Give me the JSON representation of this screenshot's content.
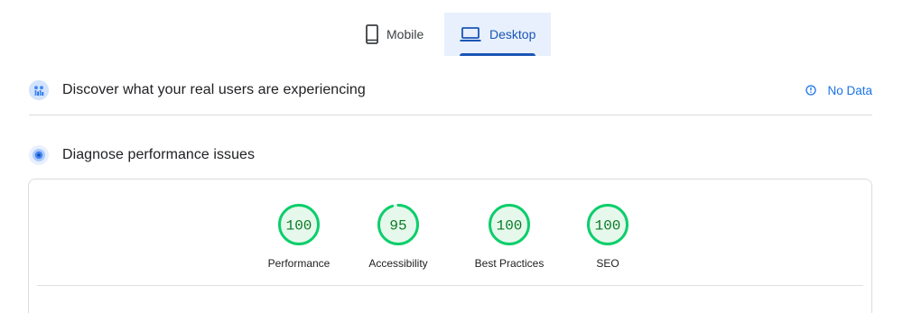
{
  "tabs": [
    {
      "label": "Mobile",
      "icon": "smartphone-icon",
      "active": false
    },
    {
      "label": "Desktop",
      "icon": "laptop-icon",
      "active": true
    }
  ],
  "field_data": {
    "title": "Discover what your real users are experiencing",
    "status": "No Data",
    "icon": "crux-users-icon",
    "status_icon": "info-icon"
  },
  "lab_data": {
    "title": "Diagnose performance issues",
    "icon": "lighthouse-gauge-icon"
  },
  "scores": [
    {
      "label": "Performance",
      "value": "100",
      "fraction": 1.0
    },
    {
      "label": "Accessibility",
      "value": "95",
      "fraction": 0.95
    },
    {
      "label": "Best Practices",
      "value": "100",
      "fraction": 1.0
    },
    {
      "label": "SEO",
      "value": "100",
      "fraction": 1.0
    }
  ],
  "colors": {
    "accent": "#1a56b5",
    "link": "#1a73e8",
    "pass": "#0cce6b",
    "pass_text": "#0b7a25",
    "pass_fill": "#e6f8ec"
  }
}
